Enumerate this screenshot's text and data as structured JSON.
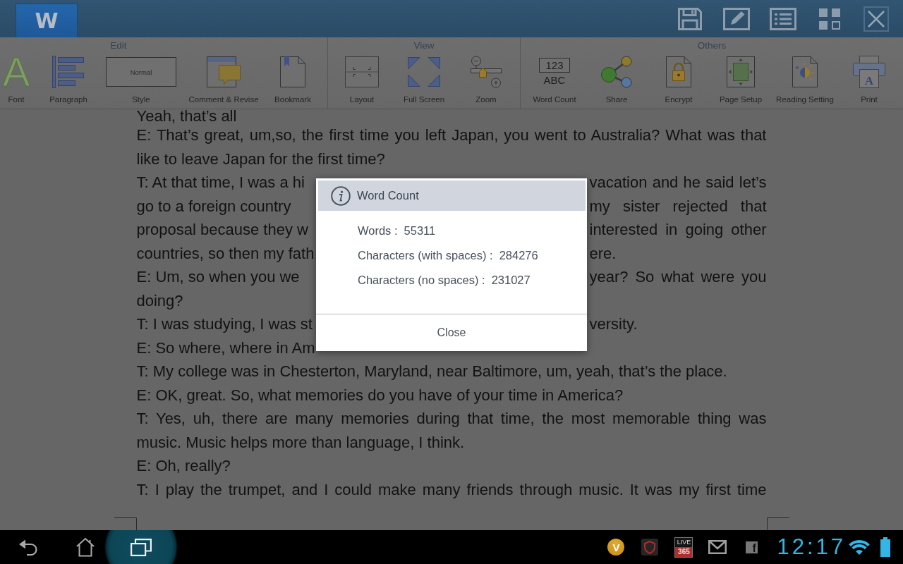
{
  "app_bar": {
    "logo": "W",
    "actions": [
      {
        "kind": "save"
      },
      {
        "kind": "edit"
      },
      {
        "kind": "list"
      },
      {
        "kind": "grid"
      },
      {
        "kind": "close"
      }
    ]
  },
  "ribbon": {
    "groups": [
      {
        "title": "Edit",
        "items": [
          {
            "kind": "font",
            "label": "Font",
            "icon_text": "A"
          },
          {
            "kind": "paragraph",
            "label": "Paragraph"
          },
          {
            "kind": "style",
            "label": "Style",
            "icon_text": "Normal"
          },
          {
            "kind": "comment",
            "label": "Comment & Revise"
          },
          {
            "kind": "bookmark",
            "label": "Bookmark"
          }
        ]
      },
      {
        "title": "View",
        "items": [
          {
            "kind": "layout",
            "label": "Layout"
          },
          {
            "kind": "fullscreen",
            "label": "Full Screen"
          },
          {
            "kind": "zoom",
            "label": "Zoom"
          }
        ]
      },
      {
        "title": "Others",
        "items": [
          {
            "kind": "wordcount",
            "label": "Word Count",
            "icon_lines": [
              "123",
              "ABC"
            ]
          },
          {
            "kind": "share",
            "label": "Share"
          },
          {
            "kind": "encrypt",
            "label": "Encrypt"
          },
          {
            "kind": "pagesetup",
            "label": "Page Setup"
          },
          {
            "kind": "reading",
            "label": "Reading Setting"
          },
          {
            "kind": "print",
            "label": "Print",
            "icon_text": "A"
          }
        ]
      }
    ]
  },
  "document": {
    "paragraphs": [
      {
        "lines": [
          {
            "kind": "full",
            "text": "Yeah, that’s all"
          }
        ]
      },
      {
        "lines": [
          {
            "kind": "full",
            "text": "E: That’s great, um,so, the first time you left Japan, you went to Australia? What was that"
          },
          {
            "kind": "full",
            "text": "like to leave Japan for the first time?"
          }
        ]
      },
      {
        "lines": [
          {
            "kind": "split",
            "left": "T: At that time, I was a hi",
            "right": "vacation and he said let’s"
          },
          {
            "kind": "split",
            "left": "go to a foreign country",
            "right": "my sister rejected that"
          },
          {
            "kind": "split",
            "left": "proposal because they w",
            "right": "interested in going other"
          },
          {
            "kind": "split",
            "left": "countries, so then my fath",
            "right": "ere."
          }
        ]
      },
      {
        "lines": [
          {
            "kind": "split",
            "left": "E: Um, so when you we",
            "right": "year? So what were you"
          },
          {
            "kind": "full",
            "text": "doing?"
          }
        ]
      },
      {
        "lines": [
          {
            "kind": "split",
            "left": "T: I was studying, I was st",
            "right": "versity."
          }
        ]
      },
      {
        "lines": [
          {
            "kind": "split",
            "left": "E: So where, where in Am"
          }
        ]
      },
      {
        "lines": [
          {
            "kind": "full",
            "text": "T: My college was in Chesterton, Maryland, near Baltimore, um, yeah, that’s the place."
          }
        ]
      },
      {
        "lines": [
          {
            "kind": "full",
            "text": "E: OK, great. So, what memories do you have of your time in America?"
          }
        ]
      },
      {
        "lines": [
          {
            "kind": "full",
            "text": "T: Yes, uh, there are many memories during that time, the most memorable thing was"
          },
          {
            "kind": "full",
            "text": "music. Music helps more than language, I think."
          }
        ]
      },
      {
        "lines": [
          {
            "kind": "full",
            "text": "E: Oh, really?"
          }
        ]
      },
      {
        "continues": true,
        "lines": [
          {
            "kind": "full",
            "text": "T: I play the trumpet, and I could make many friends through music. It was my first time"
          }
        ]
      }
    ]
  },
  "dialog": {
    "title": "Word Count",
    "stats": [
      {
        "label": "Words :",
        "value": "55311"
      },
      {
        "label": "Characters (with spaces) :",
        "value": "284276"
      },
      {
        "label": "Characters (no spaces) :",
        "value": "231027"
      }
    ],
    "button": "Close"
  },
  "system_bar": {
    "buttons": [
      {
        "kind": "back",
        "selected": false
      },
      {
        "kind": "home",
        "selected": false
      },
      {
        "kind": "recents",
        "selected": true
      }
    ],
    "notifications": [
      {
        "kind": "v",
        "text": "V"
      },
      {
        "kind": "shield"
      },
      {
        "kind": "live",
        "lines": [
          "LIVE",
          "365"
        ]
      },
      {
        "kind": "mail"
      },
      {
        "kind": "f",
        "text": "f"
      }
    ],
    "clock": "12:17"
  }
}
